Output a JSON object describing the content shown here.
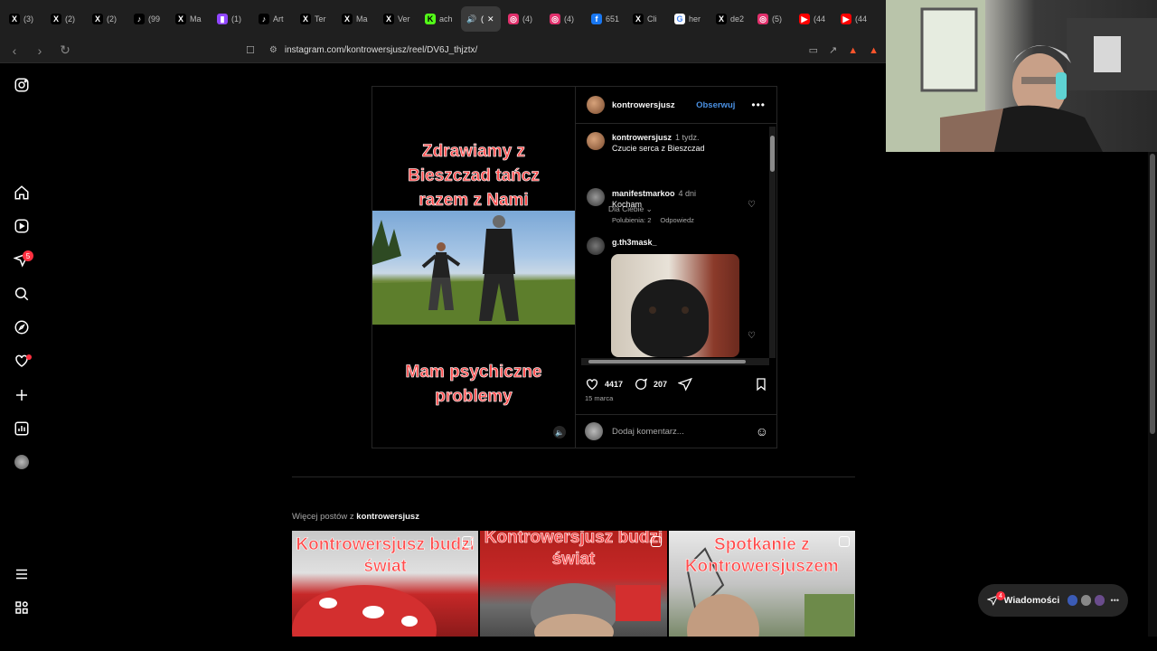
{
  "browser": {
    "tabs": [
      {
        "label": "(3)",
        "icon": "x-icon",
        "color": "#000000"
      },
      {
        "label": "(2)",
        "icon": "x-icon",
        "color": "#000000"
      },
      {
        "label": "(2)",
        "icon": "x-icon",
        "color": "#000000"
      },
      {
        "label": "(99",
        "icon": "tiktok-icon",
        "color": "#000000"
      },
      {
        "label": "Ma",
        "icon": "x-icon",
        "color": "#000000"
      },
      {
        "label": "(1)",
        "icon": "twitch-icon",
        "color": "#9146ff"
      },
      {
        "label": "Art",
        "icon": "tiktok-icon",
        "color": "#000000"
      },
      {
        "label": "Ter",
        "icon": "x-icon",
        "color": "#000000"
      },
      {
        "label": "Ma",
        "icon": "x-icon",
        "color": "#000000"
      },
      {
        "label": "Ver",
        "icon": "x-icon",
        "color": "#000000"
      },
      {
        "label": "ach",
        "icon": "kick-icon",
        "color": "#53fc18"
      },
      {
        "label": "(",
        "icon": "sound-icon",
        "color": "#3a3a3a",
        "active": true
      },
      {
        "label": "(4)",
        "icon": "instagram-icon",
        "color": "#e1306c"
      },
      {
        "label": "(4)",
        "icon": "instagram-icon",
        "color": "#e1306c"
      },
      {
        "label": "651",
        "icon": "facebook-icon",
        "color": "#1877f2"
      },
      {
        "label": "Cli",
        "icon": "x-icon",
        "color": "#000000"
      },
      {
        "label": "her",
        "icon": "google-icon",
        "color": "#ffffff"
      },
      {
        "label": "de2",
        "icon": "x-icon",
        "color": "#000000"
      },
      {
        "label": "(5)",
        "icon": "instagram-icon",
        "color": "#e1306c"
      },
      {
        "label": "(44",
        "icon": "youtube-icon",
        "color": "#ff0000"
      },
      {
        "label": "(44",
        "icon": "youtube-icon",
        "color": "#ff0000"
      }
    ],
    "url": "instagram.com/kontrowersjusz/reel/DV6J_thjztx/"
  },
  "post": {
    "video": {
      "top_text": "Zdrawiamy z Bieszczad tańcz razem z Nami",
      "bottom_text": "Mam psychiczne problemy"
    },
    "header": {
      "username": "kontrowersjusz",
      "follow_label": "Obserwuj"
    },
    "caption": {
      "username": "kontrowersjusz",
      "time": "1 tydz.",
      "text": "Czucie serca z Bieszczad"
    },
    "dla_ciebie": "Dla Ciebie",
    "comments": [
      {
        "username": "manifestmarkoo",
        "time": "4 dni",
        "text": "Kocham",
        "likes": "Polubienia: 2",
        "reply": "Odpowiedz"
      },
      {
        "username": "g.th3mask_",
        "time": "",
        "text": "",
        "likes": "",
        "reply": ""
      }
    ],
    "likes_count": "4417",
    "comments_count": "207",
    "date": "15 marca",
    "add_comment_placeholder": "Dodaj komentarz..."
  },
  "more_posts": {
    "prefix": "Więcej postów z",
    "username": "kontrowersjusz",
    "items": [
      {
        "title": "Kontrowersjusz budzi świat"
      },
      {
        "title": "Kontrowersjusz budzi świat"
      },
      {
        "title": "Spotkanie z Kontrowersjuszem"
      }
    ]
  },
  "nav": {
    "notifications_badge": "5"
  },
  "messages": {
    "label": "Wiadomości",
    "badge": "4"
  },
  "colors": {
    "accent_blue": "#4a90e2",
    "badge_red": "#ff3040",
    "overlay_text_red": "#ff4d4d"
  }
}
